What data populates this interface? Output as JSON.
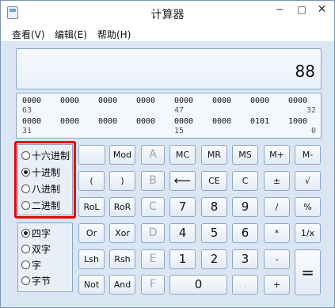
{
  "window": {
    "title": "计算器",
    "controls": {
      "minimize": "─",
      "maximize": "□",
      "close": "✕"
    }
  },
  "menu": {
    "view": "查看(V)",
    "edit": "编辑(E)",
    "help": "帮助(H)"
  },
  "display": {
    "value": "88"
  },
  "bits": {
    "row1": [
      "0000",
      "0000",
      "0000",
      "0000",
      "0000",
      "0000",
      "0000",
      "0000"
    ],
    "row1_indices": [
      "63",
      "47",
      "32"
    ],
    "row2": [
      "0000",
      "0000",
      "0000",
      "0000",
      "0000",
      "0000",
      "0101",
      "1000"
    ],
    "row2_indices": [
      "31",
      "15",
      "0"
    ]
  },
  "number_base": {
    "options": [
      "十六进制",
      "十进制",
      "八进制",
      "二进制"
    ],
    "selected": "十进制"
  },
  "word_size": {
    "options": [
      "四字",
      "双字",
      "字",
      "字节"
    ],
    "selected": "四字"
  },
  "buttons": {
    "blank": "",
    "mod": "Mod",
    "A": "A",
    "MC": "MC",
    "MR": "MR",
    "MS": "MS",
    "M_plus": "M+",
    "M_minus": "M-",
    "lparen": "(",
    "rparen": ")",
    "B": "B",
    "backspace": "⟵",
    "CE": "CE",
    "C": "C",
    "plusminus": "±",
    "sqrt": "√",
    "RoL": "RoL",
    "RoR": "RoR",
    "Cb": "C",
    "seven": "7",
    "eight": "8",
    "nine": "9",
    "divide": "/",
    "percent": "%",
    "Or": "Or",
    "Xor": "Xor",
    "D": "D",
    "four": "4",
    "five": "5",
    "six": "6",
    "multiply": "*",
    "reciprocal": "1/x",
    "Lsh": "Lsh",
    "Rsh": "Rsh",
    "E": "E",
    "one": "1",
    "two": "2",
    "three": "3",
    "minus": "-",
    "equals": "=",
    "Not": "Not",
    "And": "And",
    "F": "F",
    "zero": "0",
    "dot": ".",
    "plus": "+"
  },
  "colors": {
    "frame": "#dbe6f4",
    "highlight": "#ee0000"
  }
}
